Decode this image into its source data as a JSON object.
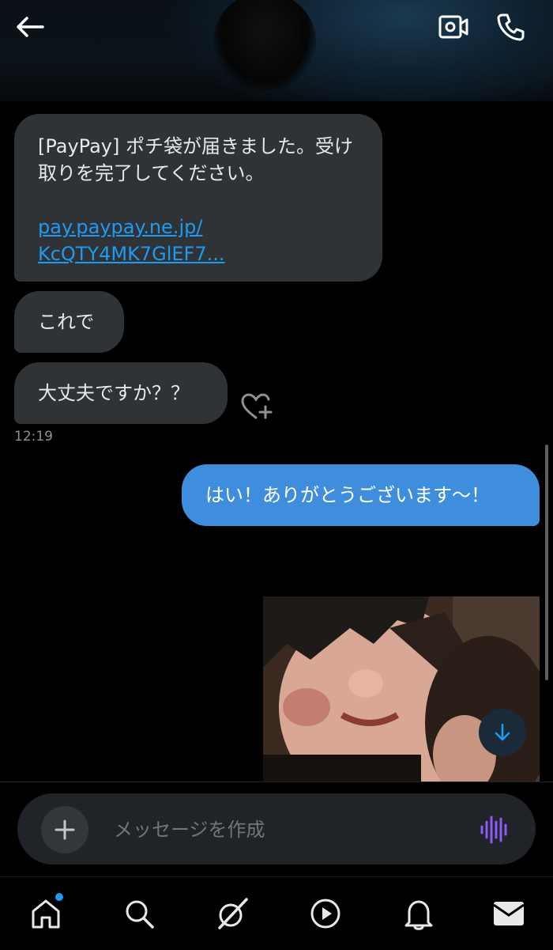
{
  "header": {
    "back_icon": "arrow-left-icon",
    "video_icon": "video-camera-icon",
    "call_icon": "phone-icon"
  },
  "messages": [
    {
      "side": "received",
      "text": "[PayPay] ポチ袋が届きました。受け取りを完了してください。",
      "link_line1": "pay.paypay.ne.jp/",
      "link_line2": "KcQTY4MK7GlEF7..."
    },
    {
      "side": "received",
      "text": "これで"
    },
    {
      "side": "received",
      "text": "大丈夫ですか？？",
      "timestamp": "12:19"
    },
    {
      "side": "sent",
      "text": "はい！ありがとうございます〜！"
    }
  ],
  "composer": {
    "placeholder": "メッセージを作成",
    "add_icon": "plus-icon",
    "voice_icon": "voice-wave-icon"
  },
  "colors": {
    "sent_bubble": "#3f8ede",
    "received_bubble": "#2f3336",
    "link": "#1d9bf0",
    "voice_icon": "#8b5cf6"
  },
  "bottom_nav": [
    {
      "name": "home",
      "icon": "home-icon",
      "has_notification_dot": true
    },
    {
      "name": "search",
      "icon": "search-icon"
    },
    {
      "name": "grok",
      "icon": "grok-icon"
    },
    {
      "name": "video",
      "icon": "play-icon"
    },
    {
      "name": "notifications",
      "icon": "bell-icon"
    },
    {
      "name": "messages",
      "icon": "mail-icon",
      "active": true
    }
  ]
}
